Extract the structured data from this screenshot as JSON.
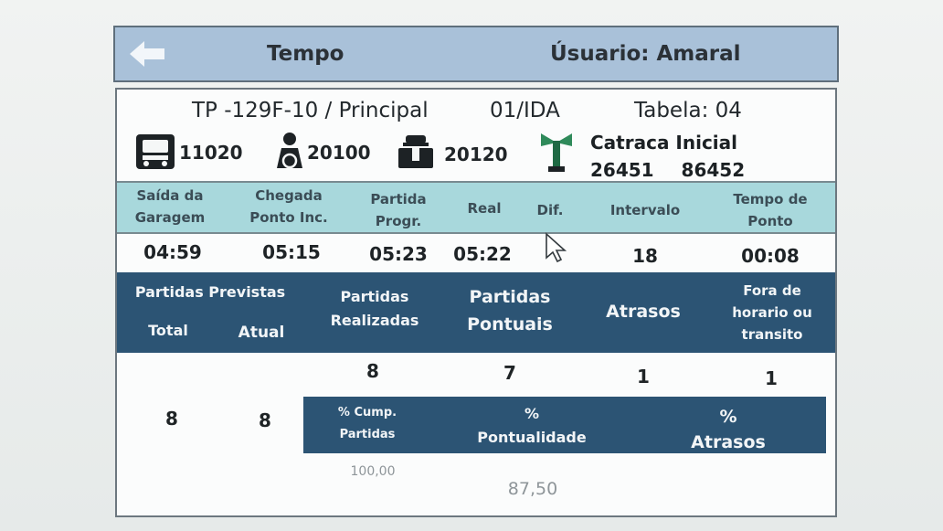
{
  "header": {
    "title": "Tempo",
    "user": "Úsuario: Amaral"
  },
  "route": {
    "line": "TP -129F-10 / Principal",
    "direction": "01/IDA",
    "tabela": "Tabela: 04"
  },
  "ids": {
    "bus": "11020",
    "driver": "20100",
    "collector": "20120"
  },
  "catraca": {
    "label": "Catraca Inicial",
    "start": "26451",
    "end": "86452"
  },
  "times_header": {
    "saida_1": "Saída da",
    "saida_2": "Garagem",
    "chegada_1": "Chegada",
    "chegada_2": "Ponto Inc.",
    "partida_1": "Partida",
    "partida_2": "Progr.",
    "real": "Real",
    "dif": "Dif.",
    "intervalo": "Intervalo",
    "tempo_1": "Tempo de",
    "tempo_2": "Ponto"
  },
  "times_values": {
    "saida": "04:59",
    "chegada": "05:15",
    "partida": "05:23",
    "real": "05:22",
    "dif": "",
    "intervalo": "18",
    "tempo": "00:08"
  },
  "stats_header": {
    "previstas": "Partidas Previstas",
    "total": "Total",
    "atual": "Atual",
    "realizadas_1": "Partidas",
    "realizadas_2": "Realizadas",
    "pontuais_1": "Partidas",
    "pontuais_2": "Pontuais",
    "atrasos": "Atrasos",
    "fora_1": "Fora de",
    "fora_2": "horario ou",
    "fora_3": "transito"
  },
  "stats_values": {
    "total": "8",
    "atual": "8",
    "realizadas": "8",
    "pontuais": "7",
    "atrasos": "1",
    "fora": "1"
  },
  "pct_header": {
    "cump_1": "% Cump.",
    "cump_2": "Partidas",
    "pont_1": "%",
    "pont_2": "Pontualidade",
    "atr_1": "%",
    "atr_2": "Atrasos"
  },
  "pct_values": {
    "cump": "100,00",
    "pont": "87,50"
  },
  "colors": {
    "header_bg": "#a9c1d9",
    "light_band": "#a8d8dc",
    "dark_band": "#2c5474",
    "turnstile_green": "#2f8a5a"
  },
  "icons": [
    "back-arrow-icon",
    "bus-icon",
    "driver-icon",
    "collector-icon",
    "turnstile-icon",
    "cursor-icon"
  ]
}
